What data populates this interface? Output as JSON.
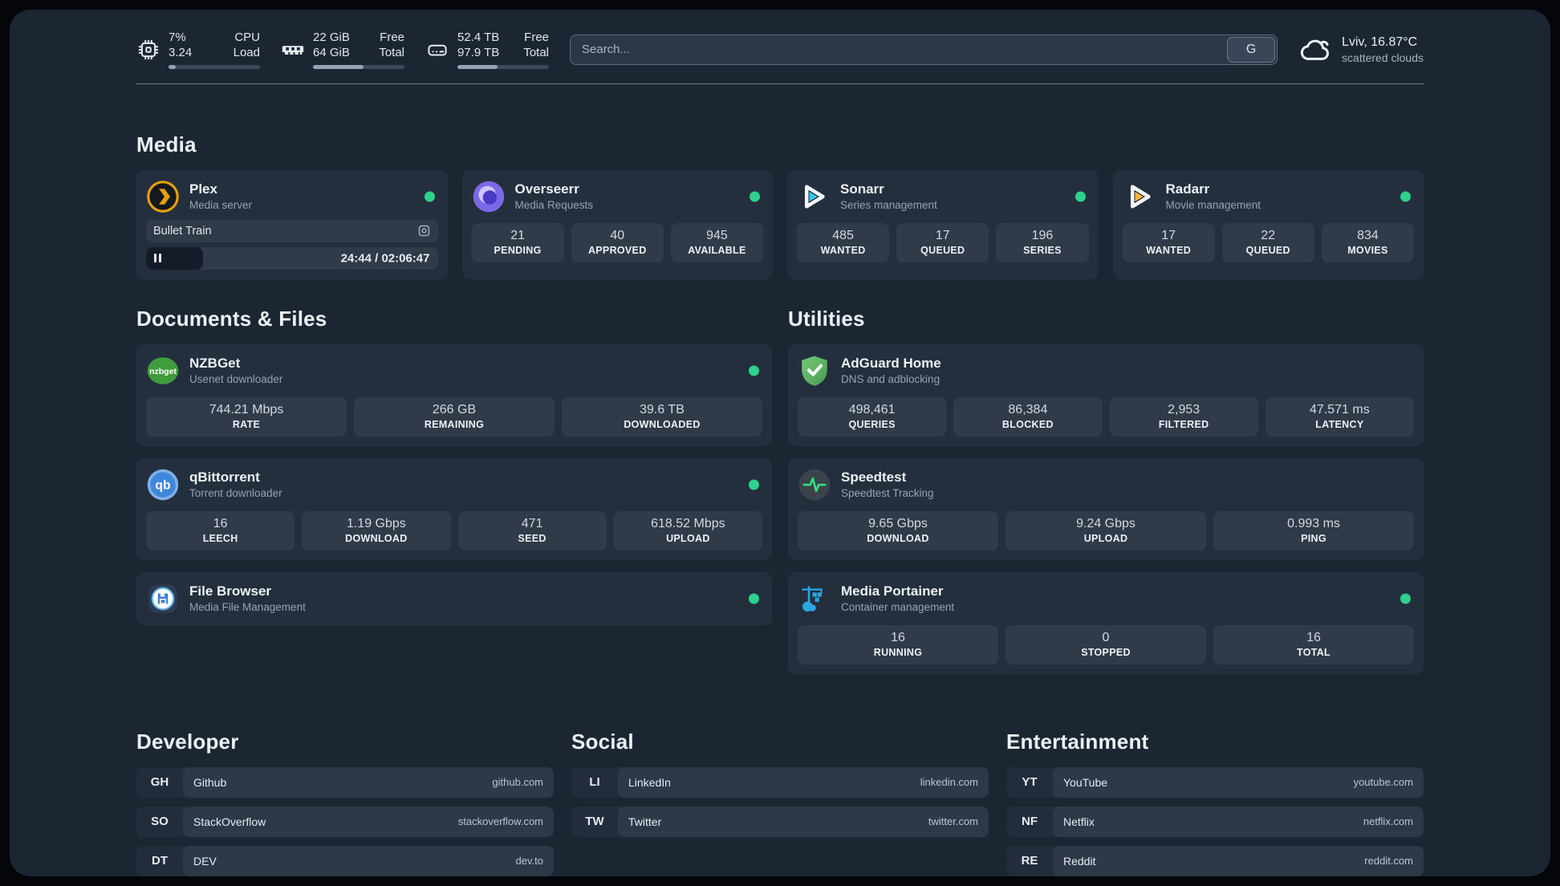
{
  "topbar": {
    "resources": [
      {
        "value_top": "7%",
        "value_bottom": "3.24",
        "label_top": "CPU",
        "label_bottom": "Load",
        "bar_style": "width:8%"
      },
      {
        "value_top": "22 GiB",
        "value_bottom": "64 GiB",
        "label_top": "Free",
        "label_bottom": "Total",
        "bar_style": "width:55%"
      },
      {
        "value_top": "52.4 TB",
        "value_bottom": "97.9 TB",
        "label_top": "Free",
        "label_bottom": "Total",
        "bar_style": "width:44%"
      }
    ],
    "search": {
      "placeholder": "Search...",
      "button_label": "G"
    },
    "weather": {
      "location": "Lviv, 16.87°C",
      "condition": "scattered clouds"
    }
  },
  "sections": {
    "media": {
      "title": "Media",
      "plex": {
        "name": "Plex",
        "desc": "Media server",
        "now_playing": "Bullet Train",
        "time": "24:44 / 02:06:47",
        "progress_style": "width:19.5%"
      },
      "overseerr": {
        "name": "Overseerr",
        "desc": "Media Requests",
        "stats": [
          {
            "value": "21",
            "label": "PENDING"
          },
          {
            "value": "40",
            "label": "APPROVED"
          },
          {
            "value": "945",
            "label": "AVAILABLE"
          }
        ]
      },
      "sonarr": {
        "name": "Sonarr",
        "desc": "Series management",
        "stats": [
          {
            "value": "485",
            "label": "WANTED"
          },
          {
            "value": "17",
            "label": "QUEUED"
          },
          {
            "value": "196",
            "label": "SERIES"
          }
        ]
      },
      "radarr": {
        "name": "Radarr",
        "desc": "Movie management",
        "stats": [
          {
            "value": "17",
            "label": "WANTED"
          },
          {
            "value": "22",
            "label": "QUEUED"
          },
          {
            "value": "834",
            "label": "MOVIES"
          }
        ]
      }
    },
    "documents": {
      "title": "Documents & Files",
      "nzbget": {
        "name": "NZBGet",
        "desc": "Usenet downloader",
        "stats": [
          {
            "value": "744.21 Mbps",
            "label": "RATE"
          },
          {
            "value": "266 GB",
            "label": "REMAINING"
          },
          {
            "value": "39.6 TB",
            "label": "DOWNLOADED"
          }
        ]
      },
      "qbittorrent": {
        "name": "qBittorrent",
        "desc": "Torrent downloader",
        "stats": [
          {
            "value": "16",
            "label": "LEECH"
          },
          {
            "value": "1.19 Gbps",
            "label": "DOWNLOAD"
          },
          {
            "value": "471",
            "label": "SEED"
          },
          {
            "value": "618.52 Mbps",
            "label": "UPLOAD"
          }
        ]
      },
      "filebrowser": {
        "name": "File Browser",
        "desc": "Media File Management"
      }
    },
    "utilities": {
      "title": "Utilities",
      "adguard": {
        "name": "AdGuard Home",
        "desc": "DNS and adblocking",
        "stats": [
          {
            "value": "498,461",
            "label": "QUERIES"
          },
          {
            "value": "86,384",
            "label": "BLOCKED"
          },
          {
            "value": "2,953",
            "label": "FILTERED"
          },
          {
            "value": "47.571 ms",
            "label": "LATENCY"
          }
        ]
      },
      "speedtest": {
        "name": "Speedtest",
        "desc": "Speedtest Tracking",
        "stats": [
          {
            "value": "9.65 Gbps",
            "label": "DOWNLOAD"
          },
          {
            "value": "9.24 Gbps",
            "label": "UPLOAD"
          },
          {
            "value": "0.993 ms",
            "label": "PING"
          }
        ]
      },
      "portainer": {
        "name": "Media Portainer",
        "desc": "Container management",
        "stats": [
          {
            "value": "16",
            "label": "RUNNING"
          },
          {
            "value": "0",
            "label": "STOPPED"
          },
          {
            "value": "16",
            "label": "TOTAL"
          }
        ]
      }
    },
    "bookmarks": [
      {
        "title": "Developer",
        "links": [
          {
            "abbr": "GH",
            "name": "Github",
            "domain": "github.com"
          },
          {
            "abbr": "SO",
            "name": "StackOverflow",
            "domain": "stackoverflow.com"
          },
          {
            "abbr": "DT",
            "name": "DEV",
            "domain": "dev.to"
          }
        ]
      },
      {
        "title": "Social",
        "links": [
          {
            "abbr": "LI",
            "name": "LinkedIn",
            "domain": "linkedin.com"
          },
          {
            "abbr": "TW",
            "name": "Twitter",
            "domain": "twitter.com"
          }
        ]
      },
      {
        "title": "Entertainment",
        "links": [
          {
            "abbr": "YT",
            "name": "YouTube",
            "domain": "youtube.com"
          },
          {
            "abbr": "NF",
            "name": "Netflix",
            "domain": "netflix.com"
          },
          {
            "abbr": "RE",
            "name": "Reddit",
            "domain": "reddit.com"
          }
        ]
      }
    ]
  },
  "colors": {
    "status_online": "#2dd28c",
    "page_bg": "#1c2633",
    "card_bg": "#242f3e",
    "plex_accent": "#e5a00d"
  }
}
